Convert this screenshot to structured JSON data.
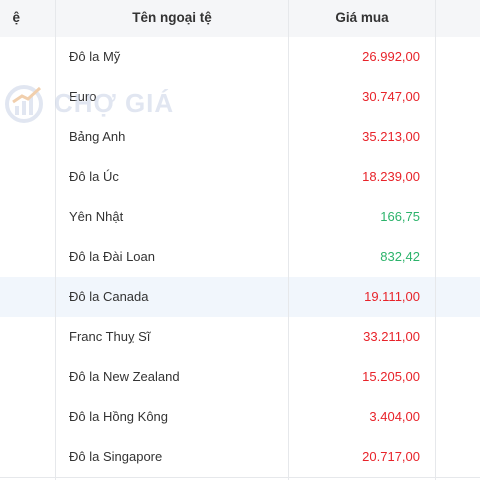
{
  "table": {
    "headers": {
      "code": "ệ",
      "name": "Tên ngoại tệ",
      "buy": "Giá mua"
    },
    "rows": [
      {
        "name": "Đô la Mỹ",
        "buy": "26.992,00",
        "color": "#e8232a"
      },
      {
        "name": "Euro",
        "buy": "30.747,00",
        "color": "#e8232a"
      },
      {
        "name": "Bảng Anh",
        "buy": "35.213,00",
        "color": "#e8232a"
      },
      {
        "name": "Đô la Úc",
        "buy": "18.239,00",
        "color": "#e8232a"
      },
      {
        "name": "Yên Nhật",
        "buy": "166,75",
        "color": "#2cb36b"
      },
      {
        "name": "Đô la Đài Loan",
        "buy": "832,42",
        "color": "#2cb36b"
      },
      {
        "name": "Đô la Canada",
        "buy": "19.111,00",
        "color": "#e8232a"
      },
      {
        "name": "Franc Thuỵ Sĩ",
        "buy": "33.211,00",
        "color": "#e8232a"
      },
      {
        "name": "Đô la New Zealand",
        "buy": "15.205,00",
        "color": "#e8232a"
      },
      {
        "name": "Đô la Hồng Kông",
        "buy": "3.404,00",
        "color": "#e8232a"
      },
      {
        "name": "Đô la Singapore",
        "buy": "20.717,00",
        "color": "#e8232a"
      }
    ],
    "highlighted_row": "Đô la Canada"
  },
  "watermark": {
    "text": "CHỢ GIÁ",
    "icon": "chart-logo-icon"
  }
}
